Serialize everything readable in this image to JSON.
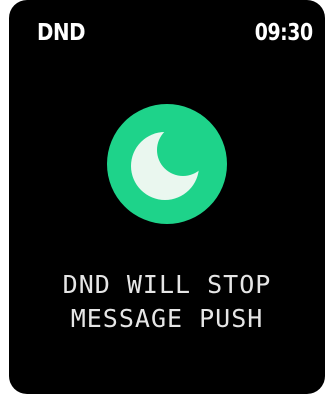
{
  "status_bar": {
    "mode_label": "DND",
    "time": "09:30"
  },
  "dnd_toggle": {
    "icon": "moon-icon",
    "color": "#1ed38a"
  },
  "message": {
    "line1": "DND WILL STOP",
    "line2": "MESSAGE PUSH"
  }
}
